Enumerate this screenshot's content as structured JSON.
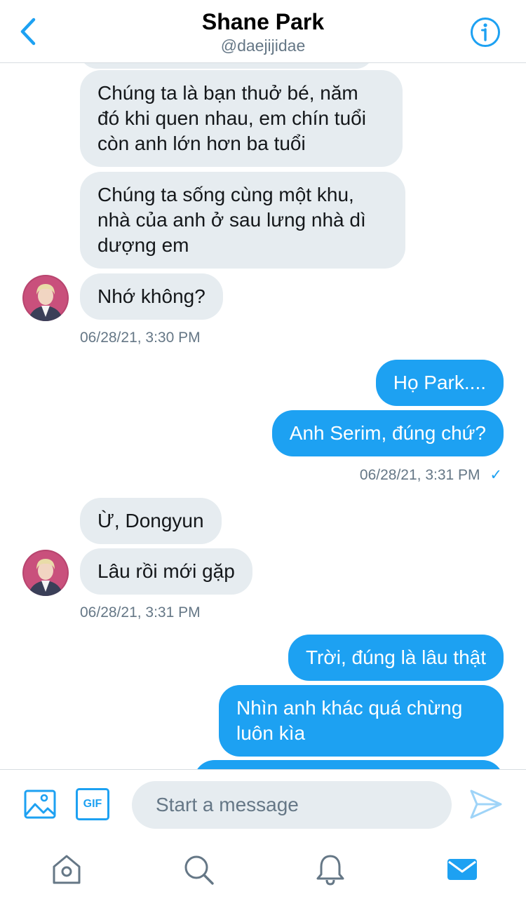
{
  "header": {
    "title": "Shane Park",
    "handle": "@daejijidae"
  },
  "messages": {
    "r1": "Chúng ta là bạn thuở bé, năm đó khi quen nhau, em chín tuổi còn anh lớn hơn ba tuổi",
    "r2": "Chúng ta sống cùng một khu, nhà của anh ở sau lưng nhà dì dượng em",
    "r3": "Nhớ không?",
    "ts1": "06/28/21, 3:30 PM",
    "s1": "Họ Park....",
    "s2": "Anh Serim, đúng chứ?",
    "ts2": "06/28/21, 3:31 PM",
    "ts2_check": "✓",
    "r4": "Ừ, Dongyun",
    "r5": "Lâu rồi mới gặp",
    "ts3": "06/28/21, 3:31 PM",
    "s3": "Trời, đúng là lâu thật",
    "s4": "Nhìn anh khác quá chừng luôn kìa"
  },
  "composer": {
    "gif_label": "GIF",
    "placeholder": "Start a message"
  },
  "colors": {
    "accent": "#1da1f2",
    "received_bubble": "#e6ecf0",
    "secondary_text": "#657786"
  },
  "tabs": [
    "home-icon",
    "search-icon",
    "notifications-icon",
    "messages-icon"
  ]
}
